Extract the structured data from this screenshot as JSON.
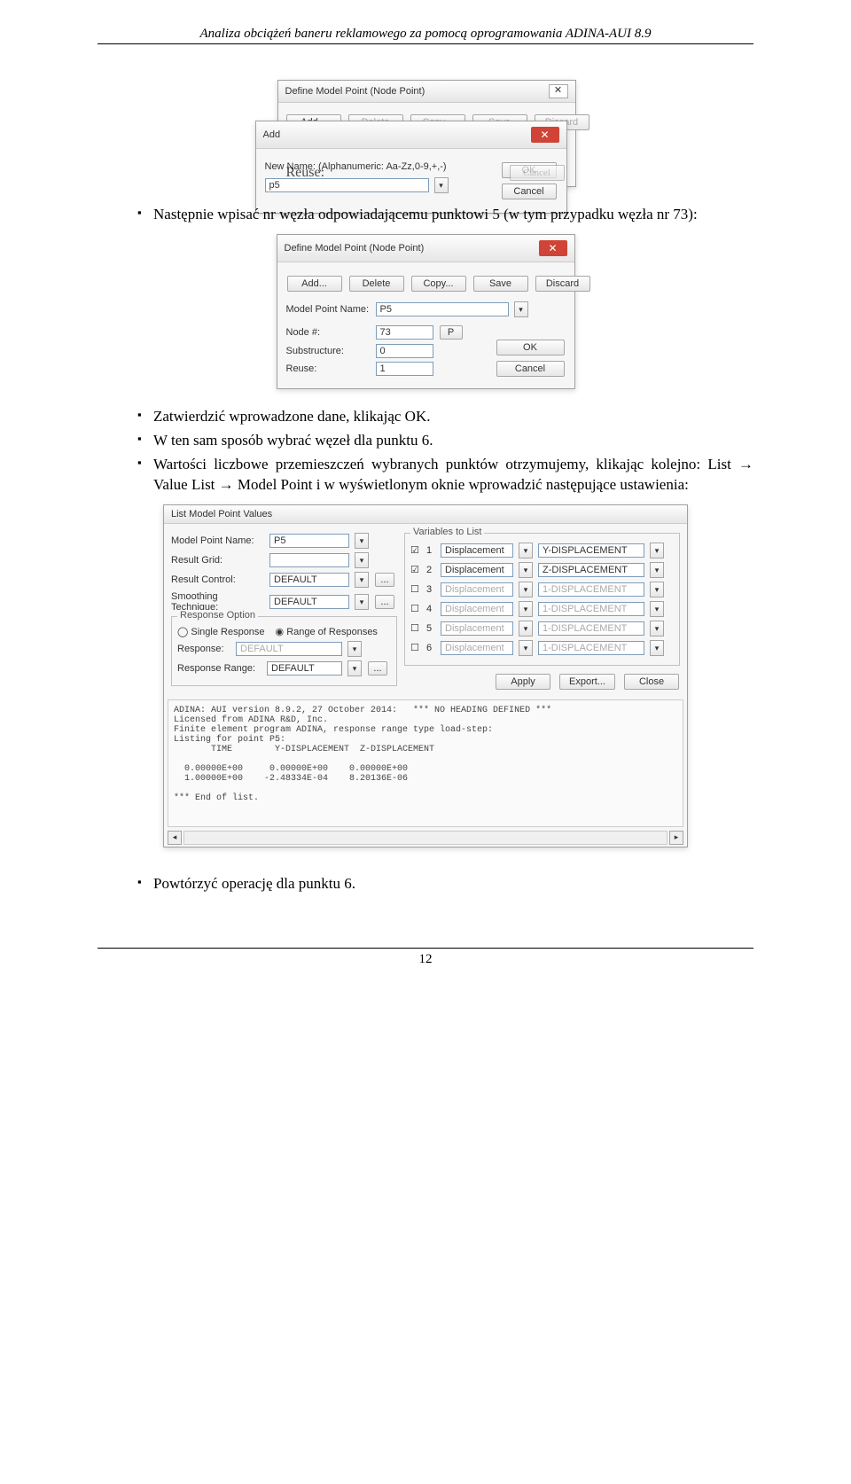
{
  "header": "Analiza obciążeń baneru reklamowego za pomocą oprogramowania ADINA-AUI 8.9",
  "page_number": "12",
  "dlg1": {
    "title": "Define Model Point (Node Point)",
    "buttons": {
      "add": "Add...",
      "del": "Delete",
      "copy": "Copy...",
      "save": "Save",
      "discard": "Discard"
    },
    "reuse_label": "Reuse:",
    "cancel": "Cancel"
  },
  "add_dlg": {
    "title": "Add",
    "newname_label": "New Name: (Alphanumeric: Aa-Zz,0-9,+,-)",
    "value": "p5",
    "ok": "OK",
    "cancel": "Cancel"
  },
  "bullet1": "Następnie wpisać nr węzła odpowiadającemu punktowi 5 (w tym przypadku węzła nr 73):",
  "dlg2": {
    "title": "Define Model Point (Node Point)",
    "buttons": {
      "add": "Add...",
      "del": "Delete",
      "copy": "Copy...",
      "save": "Save",
      "discard": "Discard"
    },
    "labels": {
      "mpn": "Model Point Name:",
      "node": "Node #:",
      "sub": "Substructure:",
      "reuse": "Reuse:"
    },
    "values": {
      "mpn": "P5",
      "node": "73",
      "node_p": "P",
      "sub": "0",
      "reuse": "1"
    },
    "ok": "OK",
    "cancel": "Cancel"
  },
  "bullets2": {
    "a": "Zatwierdzić wprowadzone dane, klikając OK.",
    "b": "W ten sam sposób wybrać węzeł dla punktu 6.",
    "c": "Wartości liczbowe przemieszczeń wybranych punktów otrzymujemy, klikając kolejno: List → Value List → Model Point i w wyświetlonym oknie wprowadzić następujące ustawienia:"
  },
  "dlg3": {
    "title": "List Model Point Values",
    "left": {
      "mpn_label": "Model Point Name:",
      "mpn_val": "P5",
      "rg_label": "Result Grid:",
      "rc_label": "Result Control:",
      "rc_val": "DEFAULT",
      "st_label": "Smoothing Technique:",
      "st_val": "DEFAULT",
      "resp_opt_label": "Response Option",
      "single": "Single Response",
      "range": "Range of Responses",
      "resp_label": "Response:",
      "resp_val": "DEFAULT",
      "rr_label": "Response Range:",
      "rr_val": "DEFAULT"
    },
    "right_title": "Variables to List",
    "vars": {
      "r1_num": "1",
      "r1_cat": "Displacement",
      "r1_val": "Y-DISPLACEMENT",
      "r1_chk": true,
      "r2_num": "2",
      "r2_cat": "Displacement",
      "r2_val": "Z-DISPLACEMENT",
      "r2_chk": true,
      "r3_num": "3",
      "r3_cat": "Displacement",
      "r3_val": "1-DISPLACEMENT",
      "r3_chk": false,
      "r4_num": "4",
      "r4_cat": "Displacement",
      "r4_val": "1-DISPLACEMENT",
      "r4_chk": false,
      "r5_num": "5",
      "r5_cat": "Displacement",
      "r5_val": "1-DISPLACEMENT",
      "r5_chk": false,
      "r6_num": "6",
      "r6_cat": "Displacement",
      "r6_val": "1-DISPLACEMENT",
      "r6_chk": false
    },
    "bottom_buttons": {
      "apply": "Apply",
      "export": "Export...",
      "close": "Close"
    },
    "output": "ADINA: AUI version 8.9.2, 27 October 2014:   *** NO HEADING DEFINED ***\nLicensed from ADINA R&D, Inc.\nFinite element program ADINA, response range type load-step:\nListing for point P5:\n       TIME        Y-DISPLACEMENT  Z-DISPLACEMENT\n\n  0.00000E+00     0.00000E+00    0.00000E+00\n  1.00000E+00    -2.48334E-04    8.20136E-06\n\n*** End of list."
  },
  "bullet3": "Powtórzyć operację  dla punktu 6."
}
